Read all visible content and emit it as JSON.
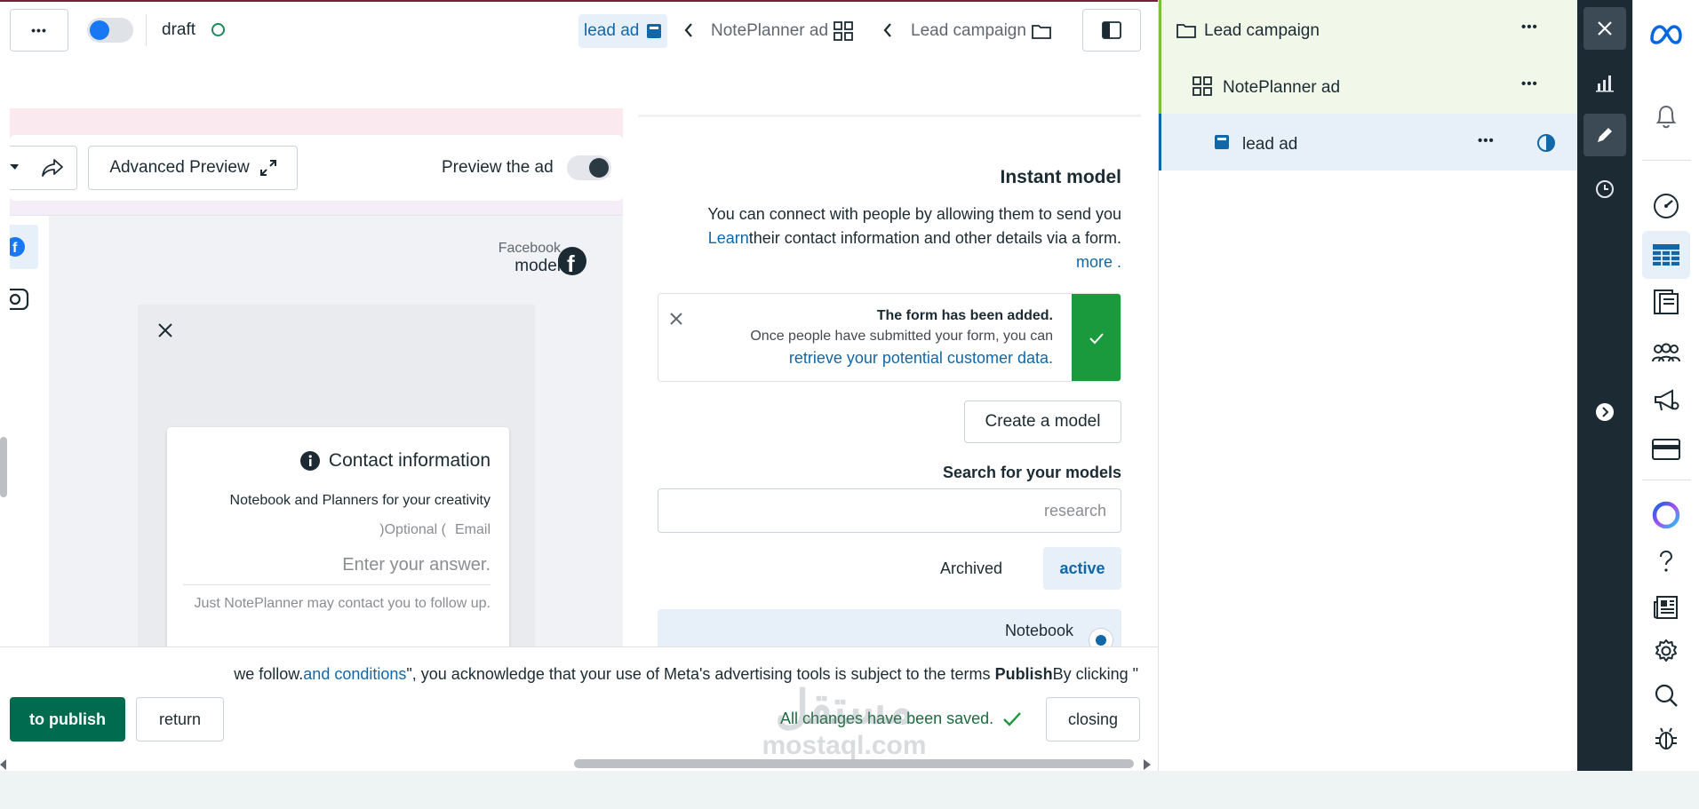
{
  "topbar": {
    "more_label": "•••",
    "status_label": "draft",
    "breadcrumb": {
      "current": "lead ad",
      "middle": "NotePlanner ad",
      "root": "Lead campaign"
    }
  },
  "preview": {
    "advanced_preview_label": "Advanced Preview",
    "preview_toggle_label": "Preview the ad",
    "platform_label_line1": "Facebook",
    "platform_label_line2": "model",
    "contact_title": "Contact information",
    "contact_subtitle": "Notebook and Planners for your creativity",
    "field_optional": ")Optional (",
    "field_label": "Email",
    "field_placeholder": "Enter your answer.",
    "field_note": "Just NotePlanner may contact you to follow up."
  },
  "instant_model": {
    "title": "Instant model",
    "desc_line1": "You can connect with people by allowing them to send you",
    "desc_learn": "Learn",
    "desc_line2": "their contact information and other details via a form.",
    "desc_more": "more .",
    "notice_title": "The form has been added.",
    "notice_text": "Once people have submitted your form, you can",
    "notice_link": "retrieve your potential customer data.",
    "create_button": "Create a model",
    "search_label": "Search for your models",
    "search_placeholder": "research",
    "tab_archived": "Archived",
    "tab_active": "active",
    "model_item": "Notebook"
  },
  "footer": {
    "terms_prefix": "we follow.",
    "terms_link": "and conditions",
    "terms_mid": "\", you acknowledge that your use of Meta's advertising tools is subject to the terms ",
    "terms_bold": "Publish",
    "terms_suffix": "By clicking \"",
    "publish_button": "to publish",
    "return_button": "return",
    "saved_status": "All changes have been saved.",
    "closing_button": "closing"
  },
  "tree": {
    "campaign": "Lead campaign",
    "adset": "NotePlanner ad",
    "ad": "lead ad",
    "more": "•••"
  },
  "watermark": {
    "arabic": "مستقل",
    "latin": "mostaql.com"
  },
  "colors": {
    "accent_blue": "#1167a8",
    "publish_green": "#006b4f",
    "success_green": "#1a9a3c",
    "rail_dark": "#1c2b33"
  }
}
